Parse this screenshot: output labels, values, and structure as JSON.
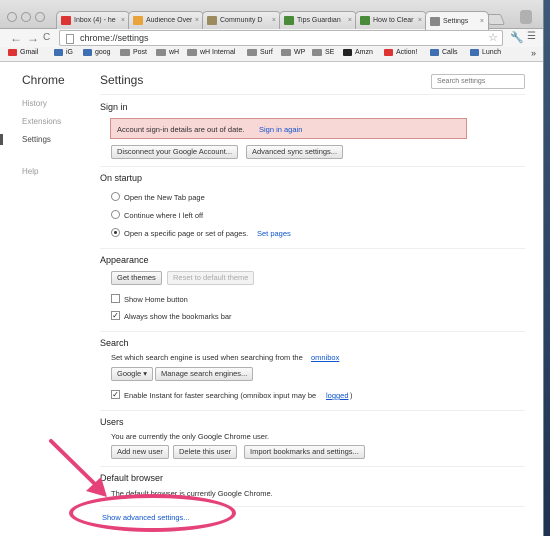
{
  "tabs": [
    {
      "label": "Inbox (4) - he",
      "fav": "#d33"
    },
    {
      "label": "Audience Over",
      "fav": "#e8a33b"
    },
    {
      "label": "Community D",
      "fav": "#9c8b5f"
    },
    {
      "label": "Tips Guardian",
      "fav": "#4a8b3a"
    },
    {
      "label": "How to Clear",
      "fav": "#4a8b3a"
    },
    {
      "label": "Settings",
      "fav": "#888"
    }
  ],
  "tab_close": "×",
  "toolbar": {
    "back": "←",
    "forward": "→",
    "reload": "C",
    "url": "chrome://settings",
    "star": "☆"
  },
  "bookmarks": [
    {
      "label": "Gmail",
      "kind": "icon",
      "color": "#d33"
    },
    {
      "label": "iG",
      "kind": "icon",
      "color": "#3f6fb0"
    },
    {
      "label": "goog",
      "kind": "icon",
      "color": "#3f6fb0"
    },
    {
      "label": "Post",
      "kind": "folder"
    },
    {
      "label": "wH",
      "kind": "folder"
    },
    {
      "label": "wH Internal",
      "kind": "folder"
    },
    {
      "label": "Surf",
      "kind": "folder"
    },
    {
      "label": "WP",
      "kind": "folder"
    },
    {
      "label": "SE",
      "kind": "folder"
    },
    {
      "label": "Amzn",
      "kind": "icon",
      "color": "#222"
    },
    {
      "label": "Action!",
      "kind": "icon",
      "color": "#d33"
    },
    {
      "label": "Calls",
      "kind": "icon",
      "color": "#3f6fb0"
    },
    {
      "label": "Lunch",
      "kind": "icon",
      "color": "#3f6fb0"
    }
  ],
  "bookmarks_more": "»",
  "nav": {
    "title": "Chrome",
    "items": [
      "History",
      "Extensions",
      "Settings",
      "Help"
    ],
    "selected": "Settings"
  },
  "page": {
    "title": "Settings",
    "search_placeholder": "Search settings"
  },
  "signin": {
    "title": "Sign in",
    "alert_text": "Account sign-in details are out of date.",
    "alert_link": "Sign in again",
    "disconnect": "Disconnect your Google Account...",
    "advanced_sync": "Advanced sync settings..."
  },
  "startup": {
    "title": "On startup",
    "options": [
      "Open the New Tab page",
      "Continue where I left off",
      "Open a specific page or set of pages."
    ],
    "selected_index": 2,
    "set_pages": "Set pages"
  },
  "appearance": {
    "title": "Appearance",
    "get_themes": "Get themes",
    "reset_theme": "Reset to default theme",
    "show_home": "Show Home button",
    "show_home_checked": false,
    "show_bookmarks": "Always show the bookmarks bar",
    "show_bookmarks_checked": true
  },
  "search": {
    "title": "Search",
    "desc": "Set which search engine is used when searching from the",
    "desc_link": "omnibox",
    "engine": "Google",
    "manage": "Manage search engines...",
    "instant": "Enable Instant for faster searching (omnibox input may be",
    "instant_link": "logged",
    "instant_end": ")",
    "instant_checked": true
  },
  "users": {
    "title": "Users",
    "desc": "You are currently the only Google Chrome user.",
    "add": "Add new user",
    "delete": "Delete this user",
    "import": "Import bookmarks and settings..."
  },
  "default_browser": {
    "title": "Default browser",
    "desc": "The default browser is currently Google Chrome."
  },
  "advanced_link": "Show advanced settings...",
  "colors": {
    "annotation": "#e6427a",
    "link": "#1155cc",
    "alert_bg": "#f8d7d7"
  }
}
